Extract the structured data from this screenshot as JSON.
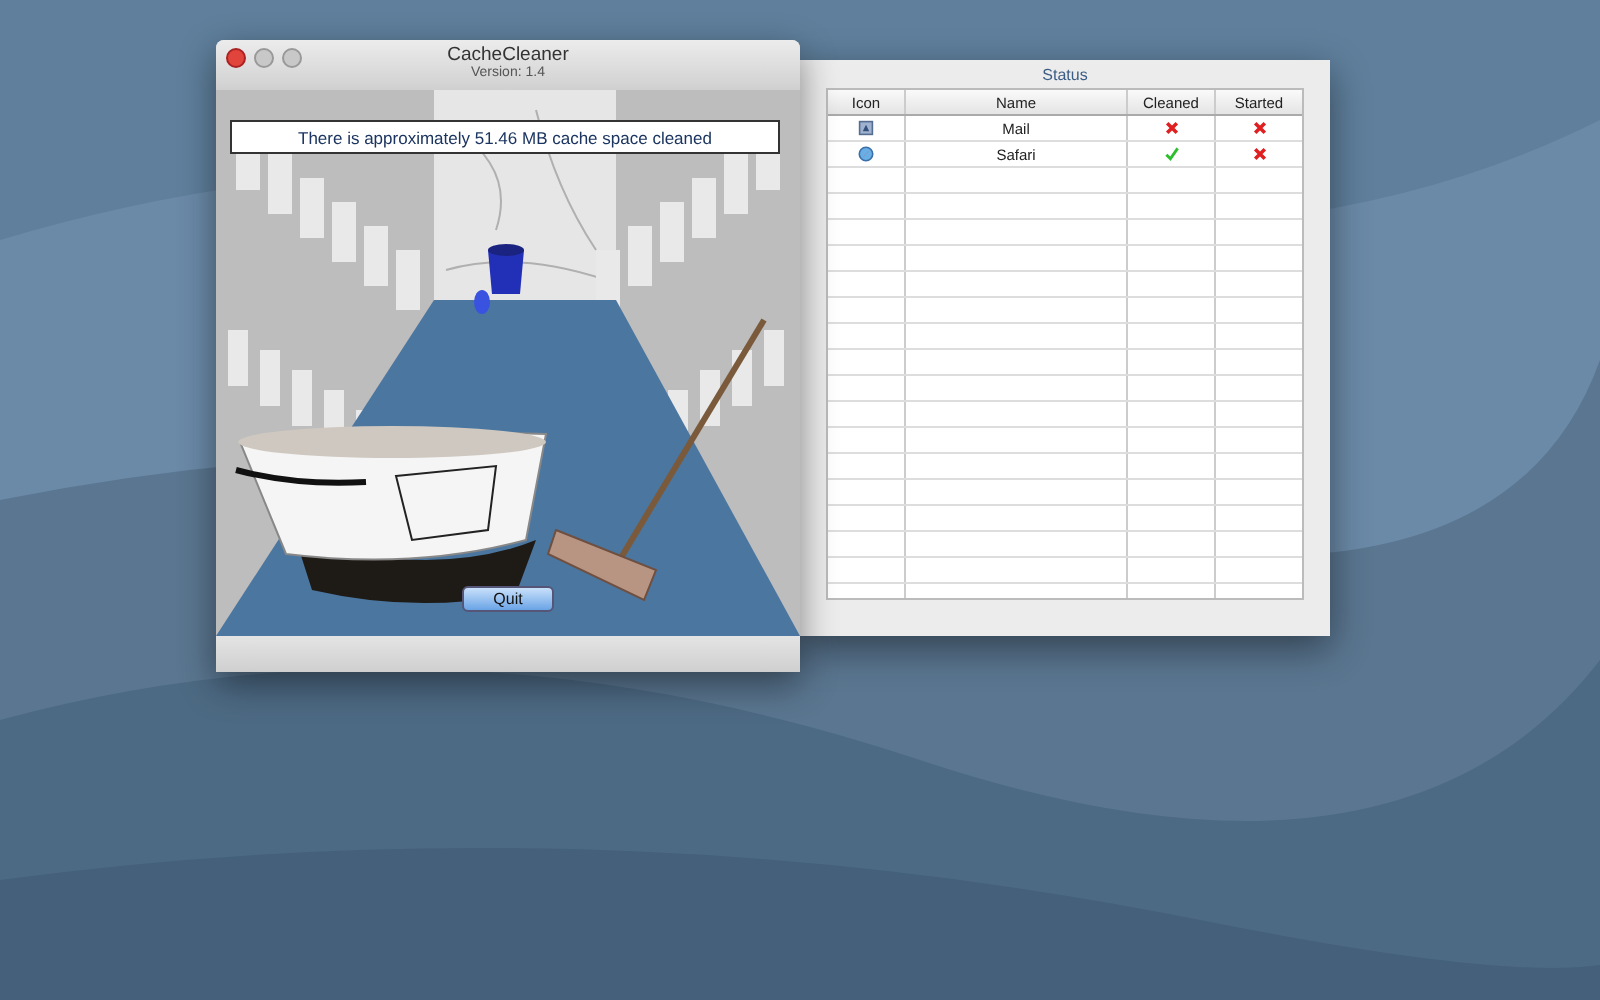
{
  "main_window": {
    "title": "CacheCleaner",
    "subtitle": "Version: 1.4",
    "message": "There is approximately 51.46 MB cache space cleaned",
    "quit_button": "Quit"
  },
  "status_window": {
    "title": "Status",
    "columns": [
      "Icon",
      "Name",
      "Cleaned",
      "Started"
    ],
    "rows": [
      {
        "name": "Mail",
        "cleaned": false,
        "started": false
      },
      {
        "name": "Safari",
        "cleaned": true,
        "started": false
      }
    ]
  }
}
